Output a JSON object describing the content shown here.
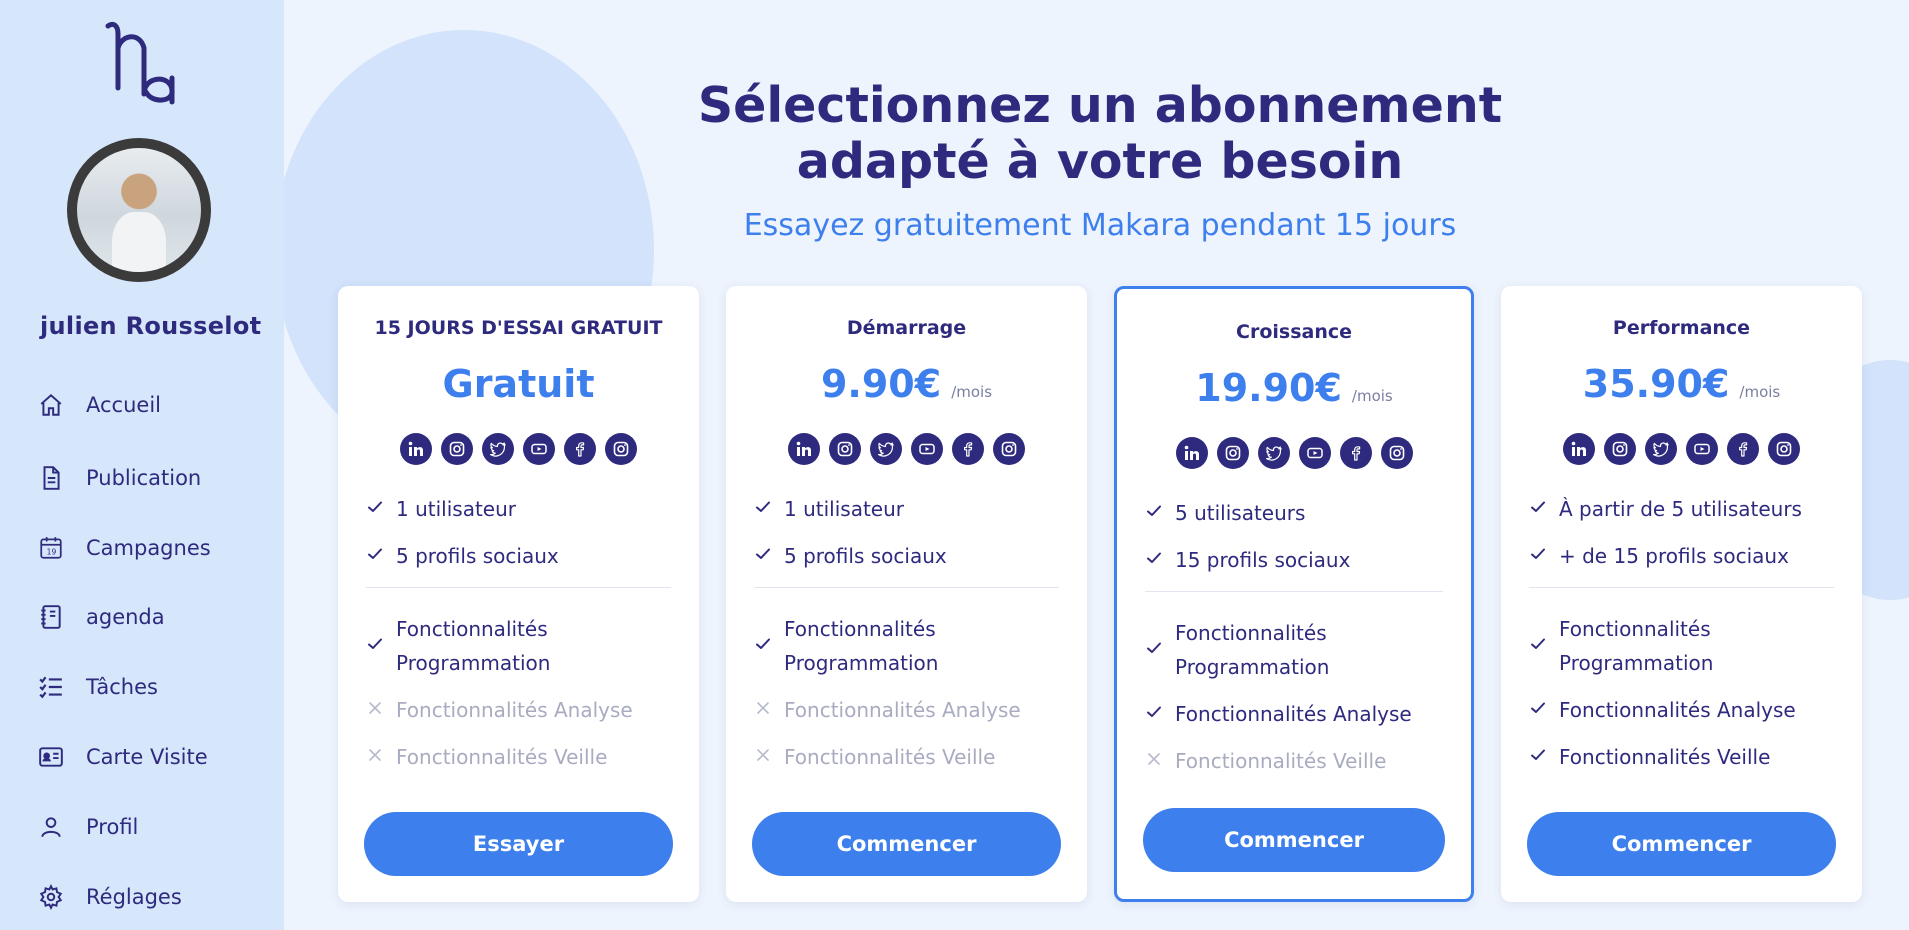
{
  "user": {
    "name": "julien Rousselot"
  },
  "nav": [
    {
      "label": "Accueil",
      "icon": "home-icon"
    },
    {
      "label": "Publication",
      "icon": "document-icon"
    },
    {
      "label": "Campagnes",
      "icon": "calendar-icon"
    },
    {
      "label": "agenda",
      "icon": "notebook-icon"
    },
    {
      "label": "Tâches",
      "icon": "checklist-icon"
    },
    {
      "label": "Carte Visite",
      "icon": "id-card-icon"
    },
    {
      "label": "Profil",
      "icon": "user-icon"
    },
    {
      "label": "Réglages",
      "icon": "gear-icon"
    }
  ],
  "header": {
    "title_line1": "Sélectionnez un abonnement",
    "title_line2": "adapté à votre besoin",
    "subtitle": "Essayez gratuitement Makara pendant 15 jours"
  },
  "plans": [
    {
      "name": "15 JOURS D'ESSAI GRATUIT",
      "price": "Gratuit",
      "per": "",
      "features": [
        {
          "text": "1 utilisateur",
          "included": true
        },
        {
          "text": "5 profils sociaux",
          "included": true
        },
        {
          "text": "Fonctionnalités Programmation",
          "included": true
        },
        {
          "text": "Fonctionnalités Analyse",
          "included": false
        },
        {
          "text": "Fonctionnalités Veille",
          "included": false
        }
      ],
      "button": "Essayer"
    },
    {
      "name": "Démarrage",
      "price": "9.90€",
      "per": "/mois",
      "features": [
        {
          "text": "1 utilisateur",
          "included": true
        },
        {
          "text": "5 profils sociaux",
          "included": true
        },
        {
          "text": "Fonctionnalités Programmation",
          "included": true
        },
        {
          "text": "Fonctionnalités Analyse",
          "included": false
        },
        {
          "text": "Fonctionnalités Veille",
          "included": false
        }
      ],
      "button": "Commencer"
    },
    {
      "name": "Croissance",
      "price": "19.90€",
      "per": "/mois",
      "featured": true,
      "features": [
        {
          "text": "5 utilisateurs",
          "included": true
        },
        {
          "text": "15 profils sociaux",
          "included": true
        },
        {
          "text": "Fonctionnalités Programmation",
          "included": true
        },
        {
          "text": "Fonctionnalités Analyse",
          "included": true
        },
        {
          "text": "Fonctionnalités Veille",
          "included": false
        }
      ],
      "button": "Commencer"
    },
    {
      "name": "Performance",
      "price": "35.90€",
      "per": "/mois",
      "features": [
        {
          "text": "À partir de 5 utilisateurs",
          "included": true
        },
        {
          "text": "+ de 15 profils sociaux",
          "included": true
        },
        {
          "text": "Fonctionnalités Programmation",
          "included": true
        },
        {
          "text": "Fonctionnalités Analyse",
          "included": true
        },
        {
          "text": "Fonctionnalités Veille",
          "included": true
        }
      ],
      "button": "Commencer"
    }
  ],
  "social_icons": [
    "linkedin-icon",
    "instagram-icon",
    "twitter-icon",
    "youtube-icon",
    "facebook-icon",
    "instagram-icon"
  ],
  "colors": {
    "navy": "#2e2a7e",
    "accent": "#3d7fec",
    "sidebar": "#d6e6fb",
    "background": "#eef4fd"
  }
}
